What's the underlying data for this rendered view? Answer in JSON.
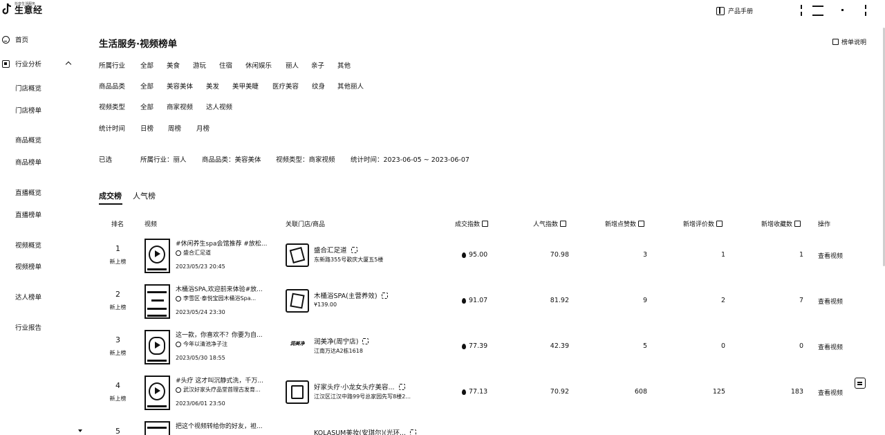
{
  "brand": {
    "tiny": "抖音生活服务",
    "name": "生意经"
  },
  "header": {
    "manual_label": "产品手册"
  },
  "sidebar": {
    "home": "首页",
    "analysis": "行业分析",
    "items": [
      "门店概览",
      "门店榜单",
      "商品概览",
      "商品榜单",
      "直播概览",
      "直播榜单",
      "视频概览",
      "视频榜单",
      "达人榜单",
      "行业报告"
    ]
  },
  "page": {
    "title": "生活服务·视频榜单",
    "explain_label": "榜单说明"
  },
  "filters": {
    "industry": {
      "label": "所属行业",
      "options": [
        "全部",
        "美食",
        "游玩",
        "住宿",
        "休闲娱乐",
        "丽人",
        "亲子",
        "其他"
      ]
    },
    "category": {
      "label": "商品品类",
      "options": [
        "全部",
        "美容美体",
        "美发",
        "美甲美睫",
        "医疗美容",
        "纹身",
        "其他丽人"
      ]
    },
    "video_type": {
      "label": "视频类型",
      "options": [
        "全部",
        "商家视频",
        "达人视频"
      ]
    },
    "period": {
      "label": "统计时间",
      "options": [
        "日榜",
        "周榜",
        "月榜"
      ]
    }
  },
  "selected": {
    "label": "已选",
    "industry": "所属行业：丽人",
    "category": "商品品类：美容美体",
    "video_type": "视频类型：商家视频",
    "period": "统计时间：2023-06-05 ~ 2023-06-07"
  },
  "tabs": [
    "成交榜",
    "人气榜"
  ],
  "table": {
    "headers": {
      "rank": "排名",
      "video": "视频",
      "shop": "关联门店/商品",
      "deal": "成交指数",
      "popularity": "人气指数",
      "likes": "新增点赞数",
      "comments": "新增评价数",
      "favorites": "新增收藏数",
      "action": "操作"
    },
    "rows": [
      {
        "rank": "1",
        "tag": "新上榜",
        "title": "#休闲养生spa会馆推荐 #放松...",
        "author": "盛合汇足道",
        "time": "2023/05/23 20:45",
        "shop": "盛合汇足道",
        "shop_sub": "东新路355号歌庆大厦五5楼",
        "deal": "95.00",
        "popularity": "70.98",
        "likes": "3",
        "comments": "1",
        "favorites": "1",
        "action": "查看视频"
      },
      {
        "rank": "2",
        "tag": "新上榜",
        "title": "木桶浴SPA,欢迎前来体验#放...",
        "author": "李雪区·泰悦宝园木桶浴Spa...",
        "time": "2023/05/24 23:30",
        "shop": "木桶浴SPA(主营养效)",
        "shop_sub": "¥139.00",
        "deal": "91.07",
        "popularity": "81.92",
        "likes": "9",
        "comments": "2",
        "favorites": "7",
        "action": "查看视频"
      },
      {
        "rank": "3",
        "tag": "新上榜",
        "title": "这一款，你喜欢不？你要为自...",
        "author": "今年以清池净子注",
        "time": "2023/05/30 18:55",
        "shop": "润美净(周宁店)",
        "shop_logo_text": "润美净",
        "shop_sub": "江南万达A2栋1618",
        "deal": "77.39",
        "popularity": "42.39",
        "likes": "5",
        "comments": "0",
        "favorites": "0",
        "action": "查看视频"
      },
      {
        "rank": "4",
        "tag": "新上榜",
        "title": "#头疗 这才叫沉静式洗，千万...",
        "author": "武汉好家头疗品堂首理古发育...",
        "time": "2023/06/01 23:50",
        "shop": "好家头疗·小龙女头疗美容...",
        "shop_sub": "江汉区江汉中路99号总家园先写8楼2...",
        "deal": "77.13",
        "popularity": "70.92",
        "likes": "608",
        "comments": "125",
        "favorites": "183",
        "action": "查看视频"
      },
      {
        "rank": "5",
        "tag": "",
        "title": "把这个视频转给你的好友，袒...",
        "author": "",
        "time": "",
        "shop": "KOLASUM美妆(安琪尔)(光环...",
        "shop_sub": "",
        "deal": "",
        "popularity": "",
        "likes": "",
        "comments": "",
        "favorites": "",
        "action": ""
      }
    ]
  }
}
